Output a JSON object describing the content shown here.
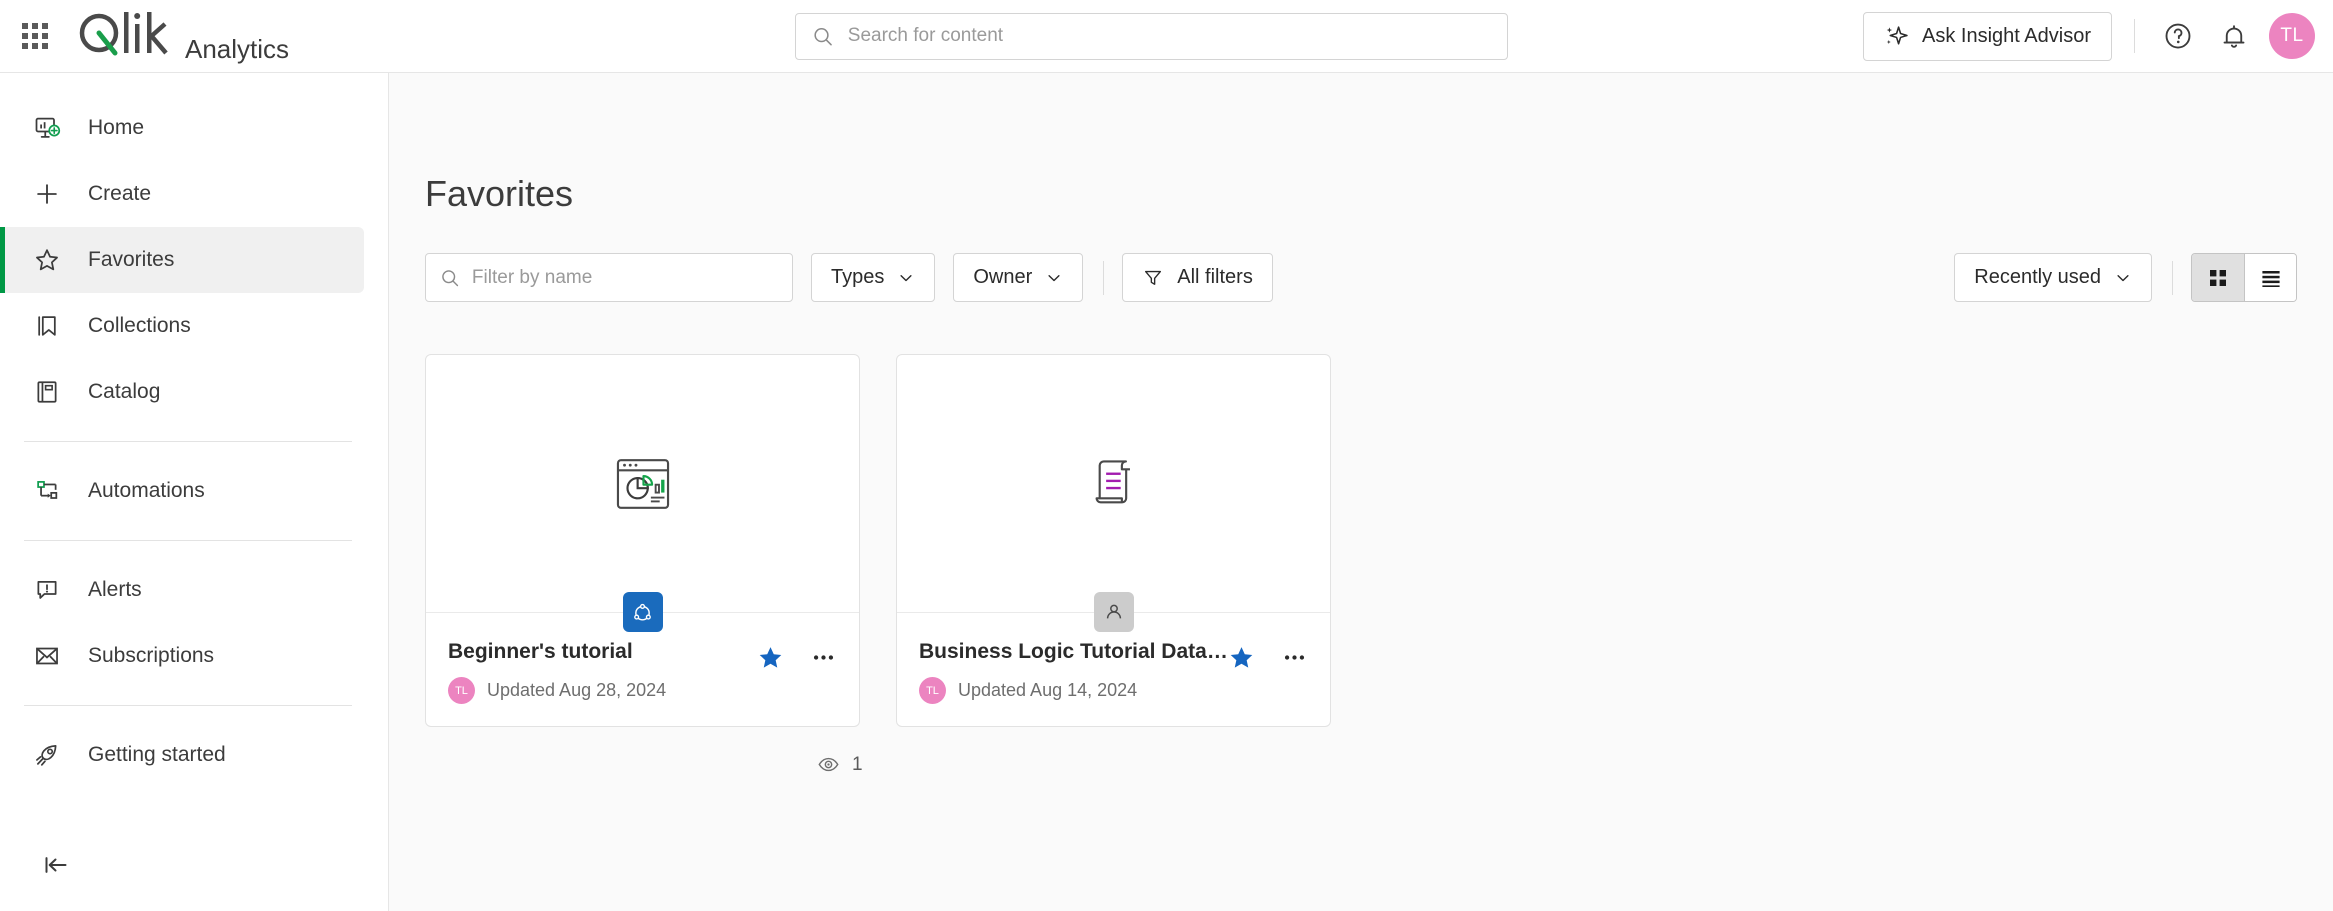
{
  "header": {
    "grid_icon": "waffle-menu-icon",
    "logo_text": "Qlik",
    "app_name": "Analytics",
    "search": {
      "placeholder": "Search for content",
      "value": "",
      "icon": "search-icon"
    },
    "insight_advisor": {
      "label": "Ask Insight Advisor",
      "icon": "sparkle-icon"
    },
    "help_icon": "help-circle-icon",
    "notifications_icon": "bell-icon",
    "avatar": {
      "initials": "TL",
      "color": "#ec84c0"
    }
  },
  "sidebar": {
    "groups": [
      {
        "items": [
          {
            "label": "Home",
            "icon": "home-dashboard-icon",
            "active": false
          },
          {
            "label": "Create",
            "icon": "plus-icon",
            "active": false
          },
          {
            "label": "Favorites",
            "icon": "star-outline-icon",
            "active": true
          },
          {
            "label": "Collections",
            "icon": "bookmark-icon",
            "active": false
          },
          {
            "label": "Catalog",
            "icon": "book-icon",
            "active": false
          }
        ]
      },
      {
        "items": [
          {
            "label": "Automations",
            "icon": "automation-flow-icon",
            "active": false
          }
        ]
      },
      {
        "items": [
          {
            "label": "Alerts",
            "icon": "alert-bubble-icon",
            "active": false
          },
          {
            "label": "Subscriptions",
            "icon": "envelope-icon",
            "active": false
          }
        ]
      },
      {
        "items": [
          {
            "label": "Getting started",
            "icon": "rocket-icon",
            "active": false
          }
        ]
      }
    ],
    "collapse_icon": "collapse-sidebar-icon",
    "active_indicator_color": "#009845"
  },
  "main": {
    "title": "Favorites",
    "toolbar": {
      "filter": {
        "placeholder": "Filter by name",
        "value": "",
        "icon": "search-icon"
      },
      "types_label": "Types",
      "owner_label": "Owner",
      "all_filters_label": "All filters",
      "all_filters_icon": "funnel-icon",
      "sort_label": "Recently used",
      "grid_view_icon": "grid-view-icon",
      "list_view_icon": "list-view-icon",
      "active_view": "grid"
    },
    "cards": [
      {
        "title": "Beginner's tutorial",
        "updated": "Updated Aug 28, 2024",
        "owner_initials": "TL",
        "thumb_icon": "chart-dashboard-icon",
        "badge_icon": "qlik-app-icon",
        "badge_type": "app",
        "favorited": true,
        "star_icon": "star-filled-icon",
        "more_icon": "more-options-icon"
      },
      {
        "title": "Business Logic Tutorial Data Prep",
        "updated": "Updated Aug 14, 2024",
        "owner_initials": "TL",
        "thumb_icon": "script-scroll-icon",
        "badge_icon": "person-icon",
        "badge_type": "script",
        "favorited": true,
        "star_icon": "star-filled-icon",
        "more_icon": "more-options-icon"
      }
    ],
    "view_count": {
      "icon": "eye-icon",
      "value": "1"
    }
  },
  "colors": {
    "brand_green": "#1a9e4b",
    "accent_blue": "#1a6bbd",
    "avatar_pink": "#ec84c0",
    "script_purple": "#a21caf"
  }
}
